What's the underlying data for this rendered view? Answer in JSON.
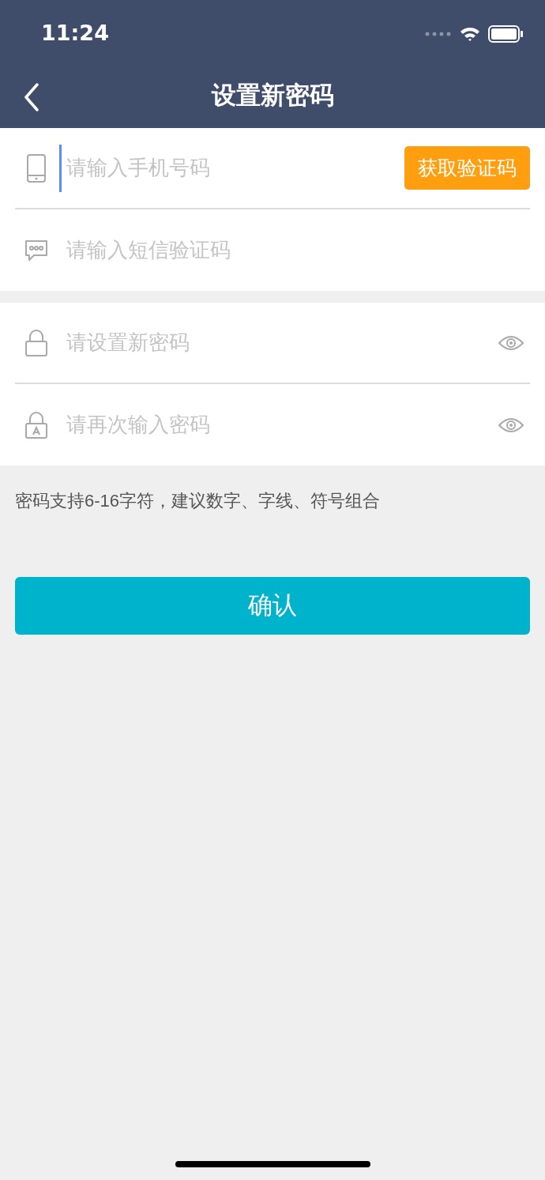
{
  "status_bar": {
    "time": "11:24"
  },
  "nav_bar": {
    "title": "设置新密码"
  },
  "groups": [
    {
      "fields": [
        {
          "kind": "phone",
          "placeholder": "请输入手机号码",
          "focused": true,
          "action": "获取验证码"
        },
        {
          "kind": "sms",
          "placeholder": "请输入短信验证码",
          "focused": false
        }
      ]
    },
    {
      "fields": [
        {
          "kind": "password",
          "placeholder": "请设置新密码",
          "focused": false
        },
        {
          "kind": "password_confirm",
          "placeholder": "请再次输入密码",
          "focused": false
        }
      ]
    }
  ],
  "hint": "密码支持6-16字符，建议数字、字线、符号组合",
  "confirm_button": "确认"
}
